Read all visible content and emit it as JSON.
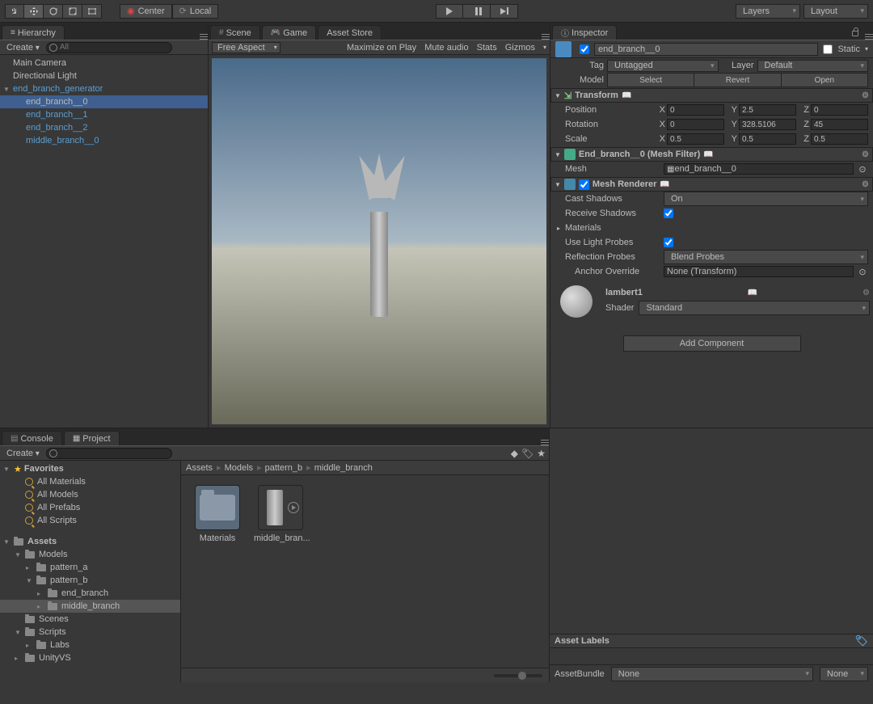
{
  "toolbar": {
    "center": "Center",
    "local": "Local",
    "layers": "Layers",
    "layout": "Layout"
  },
  "hierarchy": {
    "title": "Hierarchy",
    "create": "Create",
    "search_placeholder": "All",
    "items": [
      {
        "label": "Main Camera",
        "indent": 0,
        "blue": false,
        "selected": false,
        "arrow": ""
      },
      {
        "label": "Directional Light",
        "indent": 0,
        "blue": false,
        "selected": false,
        "arrow": ""
      },
      {
        "label": "end_branch_generator",
        "indent": 0,
        "blue": true,
        "selected": false,
        "arrow": "▼"
      },
      {
        "label": "end_branch__0",
        "indent": 1,
        "blue": true,
        "selected": true,
        "arrow": ""
      },
      {
        "label": "end_branch__1",
        "indent": 1,
        "blue": true,
        "selected": false,
        "arrow": ""
      },
      {
        "label": "end_branch__2",
        "indent": 1,
        "blue": true,
        "selected": false,
        "arrow": ""
      },
      {
        "label": "middle_branch__0",
        "indent": 1,
        "blue": true,
        "selected": false,
        "arrow": ""
      }
    ]
  },
  "tabs": {
    "scene": "Scene",
    "game": "Game",
    "asset_store": "Asset Store"
  },
  "game_toolbar": {
    "aspect": "Free Aspect",
    "maximize": "Maximize on Play",
    "mute": "Mute audio",
    "stats": "Stats",
    "gizmos": "Gizmos"
  },
  "inspector": {
    "title": "Inspector",
    "name": "end_branch__0",
    "static": "Static",
    "tag_label": "Tag",
    "tag_value": "Untagged",
    "layer_label": "Layer",
    "layer_value": "Default",
    "model_label": "Model",
    "select": "Select",
    "revert": "Revert",
    "open": "Open",
    "transform": {
      "title": "Transform",
      "position": {
        "label": "Position",
        "x": "0",
        "y": "2.5",
        "z": "0"
      },
      "rotation": {
        "label": "Rotation",
        "x": "0",
        "y": "328.5106",
        "z": "45"
      },
      "scale": {
        "label": "Scale",
        "x": "0.5",
        "y": "0.5",
        "z": "0.5"
      }
    },
    "mesh_filter": {
      "title": "End_branch__0 (Mesh Filter)",
      "mesh_label": "Mesh",
      "mesh_value": "end_branch__0"
    },
    "mesh_renderer": {
      "title": "Mesh Renderer",
      "cast_shadows": {
        "label": "Cast Shadows",
        "value": "On"
      },
      "receive_shadows": "Receive Shadows",
      "materials": "Materials",
      "light_probes": "Use Light Probes",
      "reflection": {
        "label": "Reflection Probes",
        "value": "Blend Probes"
      },
      "anchor": {
        "label": "Anchor Override",
        "value": "None (Transform)"
      }
    },
    "material": {
      "title": "lambert1",
      "shader_label": "Shader",
      "shader_value": "Standard"
    },
    "add_component": "Add Component"
  },
  "console_tab": "Console",
  "project": {
    "title": "Project",
    "create": "Create",
    "favorites": "Favorites",
    "fav_items": [
      "All Materials",
      "All Models",
      "All Prefabs",
      "All Scripts"
    ],
    "assets": "Assets",
    "tree": [
      {
        "label": "Models",
        "indent": 1,
        "arrow": "▼"
      },
      {
        "label": "pattern_a",
        "indent": 2,
        "arrow": "▸"
      },
      {
        "label": "pattern_b",
        "indent": 2,
        "arrow": "▼"
      },
      {
        "label": "end_branch",
        "indent": 3,
        "arrow": "▸"
      },
      {
        "label": "middle_branch",
        "indent": 3,
        "arrow": "▸",
        "selected": true
      },
      {
        "label": "Scenes",
        "indent": 1,
        "arrow": ""
      },
      {
        "label": "Scripts",
        "indent": 1,
        "arrow": "▼"
      },
      {
        "label": "Labs",
        "indent": 2,
        "arrow": "▸"
      },
      {
        "label": "UnityVS",
        "indent": 1,
        "arrow": "▸"
      }
    ],
    "breadcrumb": [
      "Assets",
      "Models",
      "pattern_b",
      "middle_branch"
    ],
    "items": [
      {
        "label": "Materials",
        "type": "folder"
      },
      {
        "label": "middle_bran...",
        "type": "model"
      }
    ]
  },
  "asset_labels": "Asset Labels",
  "asset_bundle": {
    "label": "AssetBundle",
    "value1": "None",
    "value2": "None"
  }
}
